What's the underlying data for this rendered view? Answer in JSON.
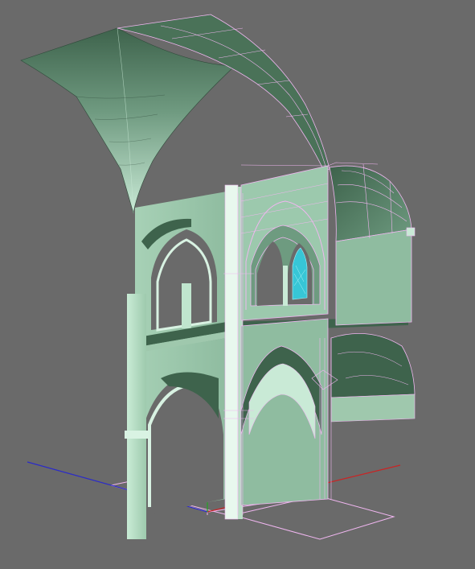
{
  "viewport": {
    "background": "#6a6a6a",
    "colors": {
      "wireframe": "#f0b6f0",
      "shade_dark": "#3e634c",
      "shade_mid": "#8db79c",
      "shade_light": "#c9ead6",
      "glass": "#37c6d6",
      "axis_x": "#cc2020",
      "axis_y": "#20a020",
      "axis_z": "#2020cc"
    }
  }
}
